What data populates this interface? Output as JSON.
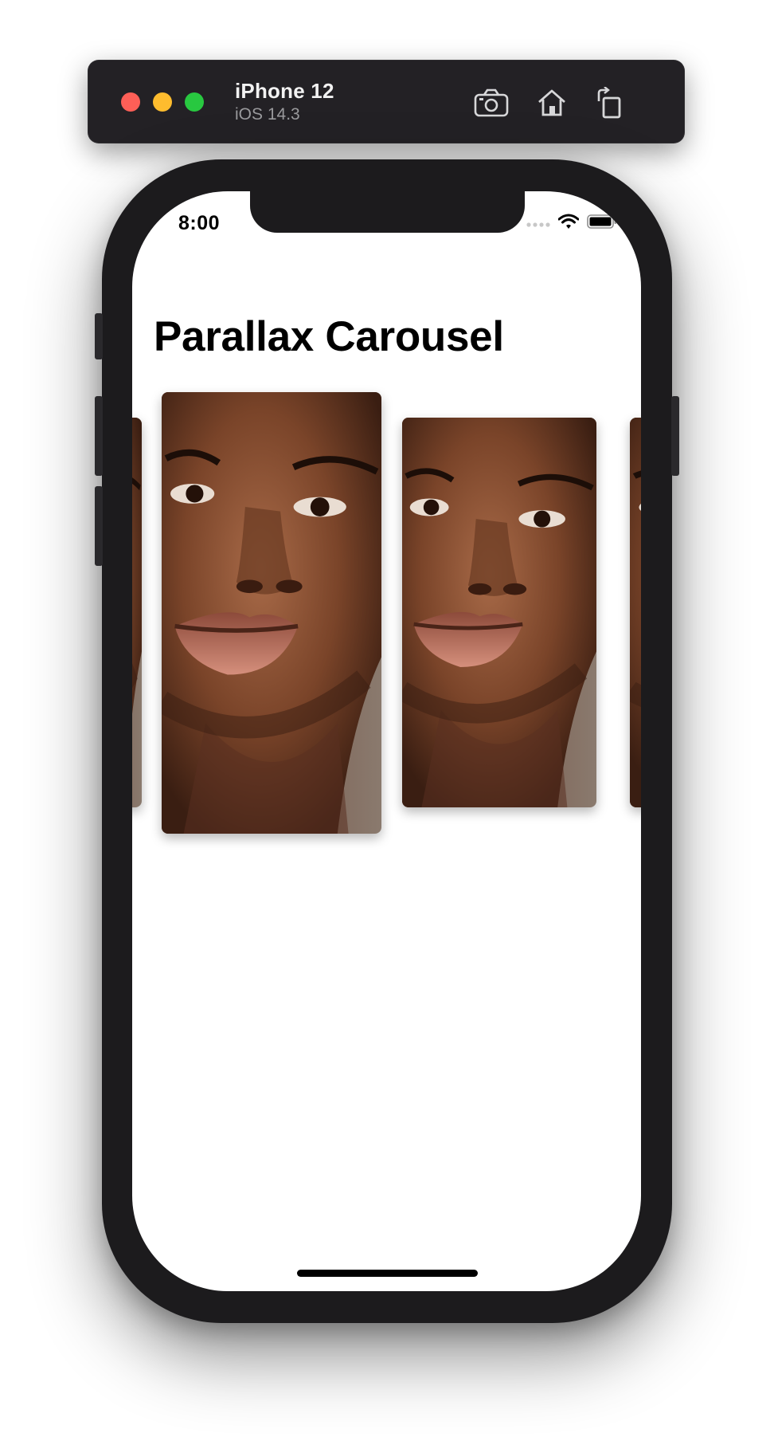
{
  "simulator": {
    "device_name": "iPhone 12",
    "os_version": "iOS 14.3",
    "controls": [
      {
        "icon": "screenshot-camera-icon",
        "label": "Save Screen"
      },
      {
        "icon": "home-icon",
        "label": "Home"
      },
      {
        "icon": "rotate-icon",
        "label": "Rotate"
      }
    ]
  },
  "status_bar": {
    "time": "8:00",
    "icons": [
      "signal-dots-icon",
      "wifi-icon",
      "battery-icon"
    ]
  },
  "screen": {
    "title": "Parallax Carousel",
    "carousel": {
      "items": [
        {
          "id": "card-1",
          "image": "portrait-photo",
          "state": "partial-left"
        },
        {
          "id": "card-2",
          "image": "portrait-photo",
          "state": "focused"
        },
        {
          "id": "card-3",
          "image": "portrait-photo",
          "state": "unfocused"
        },
        {
          "id": "card-4",
          "image": "portrait-photo",
          "state": "partial-right"
        }
      ]
    }
  },
  "colors": {
    "window_bar": "#232125",
    "device_frame": "#1c1b1d",
    "traffic_red": "#fe5f57",
    "traffic_yellow": "#febc2e",
    "traffic_green": "#28c840"
  }
}
